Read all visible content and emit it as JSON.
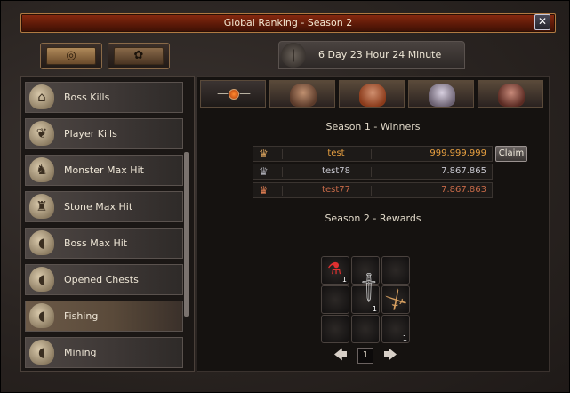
{
  "window": {
    "title": "Global Ranking - Season 2",
    "close_label": "✕"
  },
  "top_tabs": [
    {
      "name": "global-tab",
      "icon": "globe-icon",
      "glyph": "◎",
      "active": true
    },
    {
      "name": "guild-tab",
      "icon": "paw-icon",
      "glyph": "✿",
      "active": false
    }
  ],
  "timer": {
    "icon": "season-medal-icon",
    "text": "6 Day 23 Hour 24 Minute"
  },
  "sidebar": {
    "items": [
      {
        "label": "Boss Kills",
        "icon": "gate-icon",
        "glyph": "⌂"
      },
      {
        "label": "Player Kills",
        "icon": "fish-emblem-icon",
        "glyph": "❦"
      },
      {
        "label": "Monster Max Hit",
        "icon": "monster-icon",
        "glyph": "♞"
      },
      {
        "label": "Stone Max Hit",
        "icon": "stone-icon",
        "glyph": "♜"
      },
      {
        "label": "Boss Max Hit",
        "icon": "egg-icon",
        "glyph": "◖"
      },
      {
        "label": "Opened Chests",
        "icon": "egg-icon",
        "glyph": "◖"
      },
      {
        "label": "Fishing",
        "icon": "egg-icon",
        "glyph": "◖",
        "active": true
      },
      {
        "label": "Mining",
        "icon": "egg-icon",
        "glyph": "◖"
      }
    ]
  },
  "char_tabs": [
    {
      "name": "overall",
      "icon": "orb-icon"
    },
    {
      "name": "warrior",
      "color": "#9a6a4a"
    },
    {
      "name": "assassin",
      "color": "#b0603a"
    },
    {
      "name": "sura",
      "color": "#a8a0b0"
    },
    {
      "name": "shaman",
      "color": "#8a5a4a"
    }
  ],
  "winners": {
    "title": "Season 1 - Winners",
    "rows": [
      {
        "name": "test",
        "score": "999.999.999",
        "crown_color": "#e0a860",
        "text_color": "#e8a040"
      },
      {
        "name": "test78",
        "score": "7.867.865",
        "crown_color": "#a8a8b0",
        "text_color": "#c8c8d0"
      },
      {
        "name": "test77",
        "score": "7.867.863",
        "crown_color": "#d87a50",
        "text_color": "#c86a48"
      }
    ],
    "claim_label": "Claim"
  },
  "rewards": {
    "title": "Season 2 - Rewards",
    "items": [
      {
        "name": "red-potion-icon",
        "glyph": "⚗",
        "qty": "1",
        "color": "#e03030"
      },
      {
        "name": "dagger-icon",
        "glyph": "🗡",
        "qty": "1",
        "color": "#c8c8c8"
      },
      {
        "name": "sword-icon",
        "glyph": "⚔",
        "qty": "1",
        "color": "#d8a060"
      }
    ],
    "page": "1",
    "prev_label": "🡄",
    "next_label": "🡆"
  }
}
